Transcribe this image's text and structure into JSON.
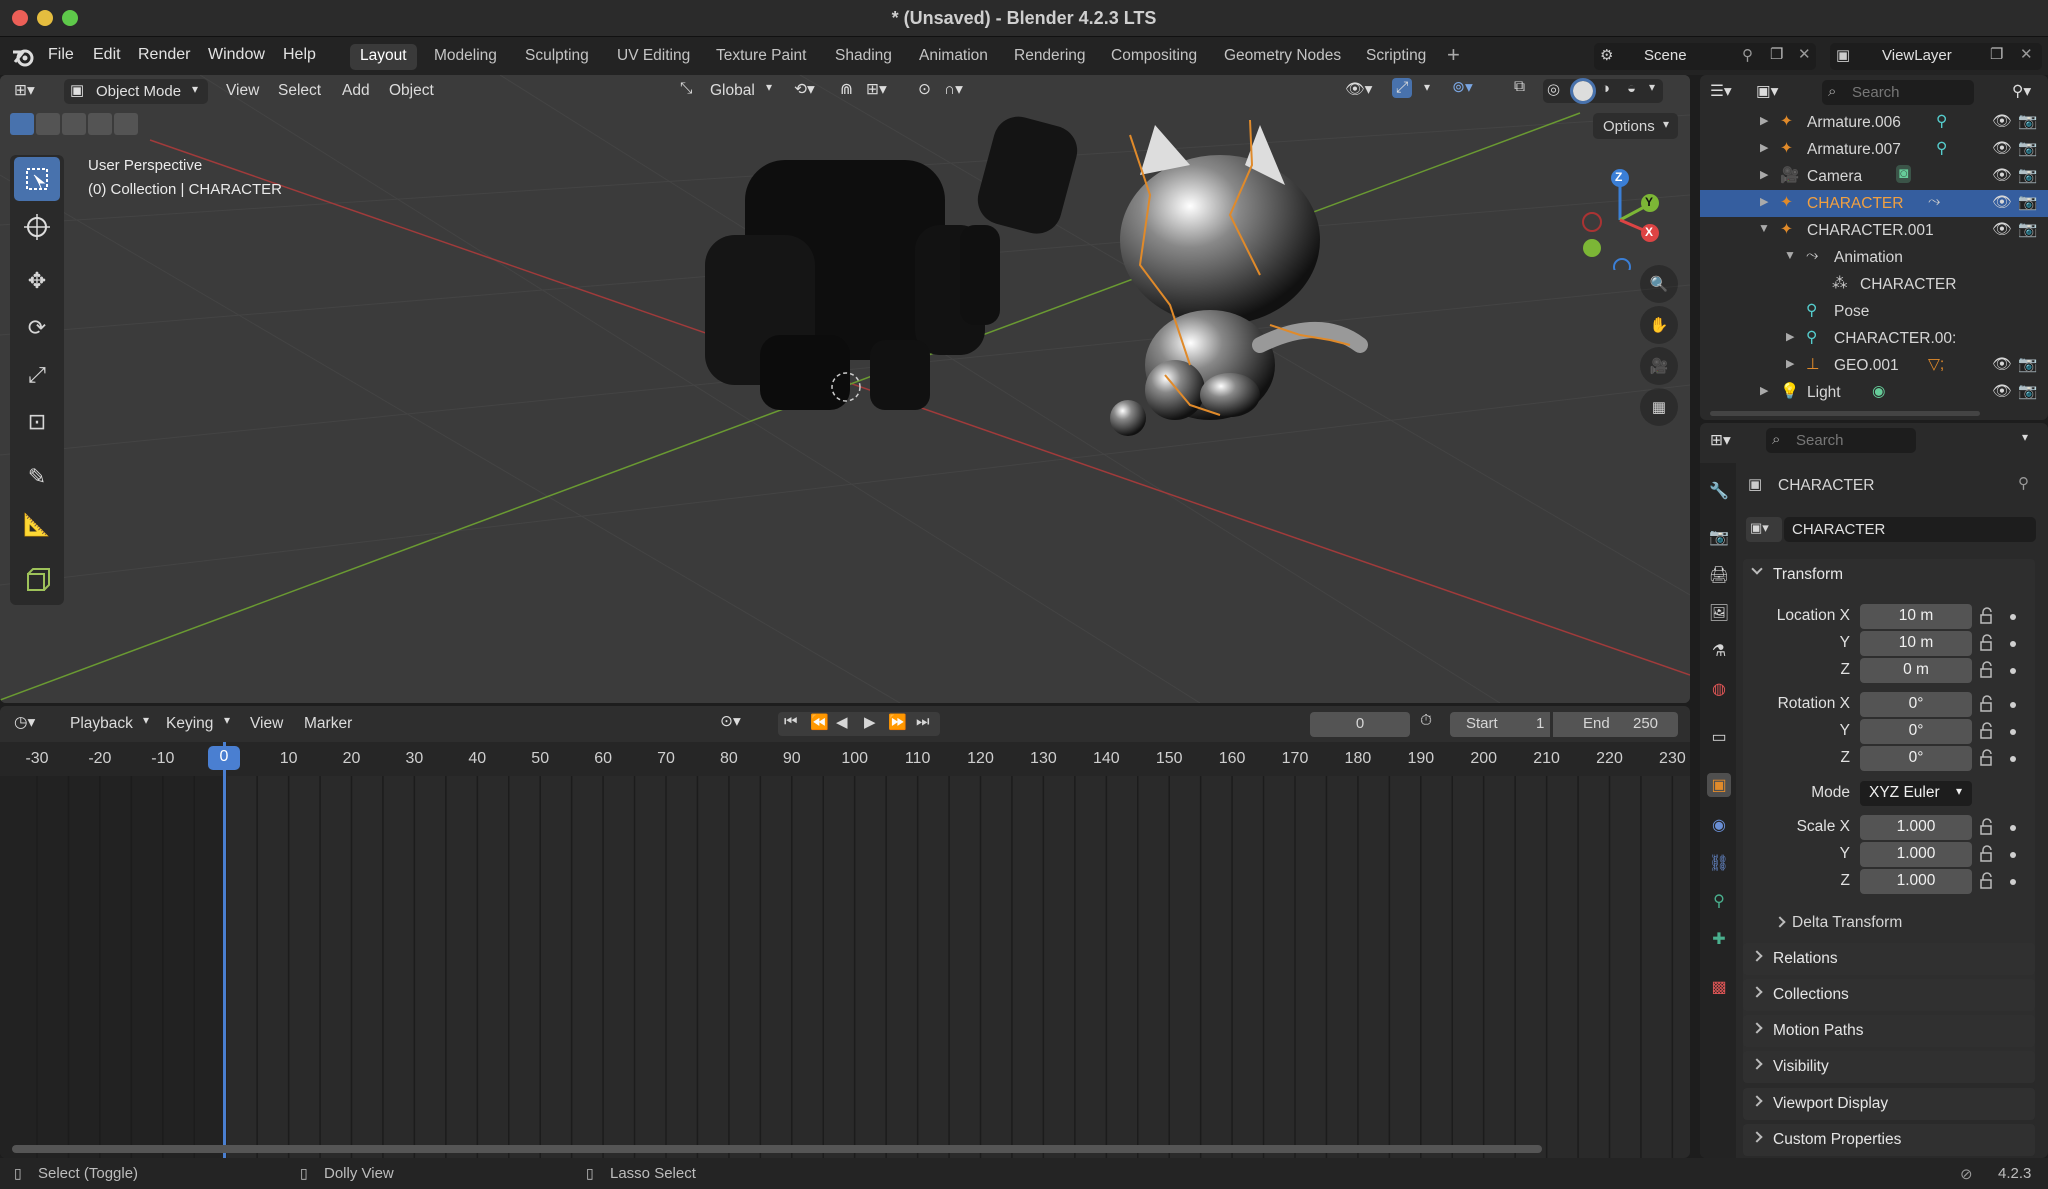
{
  "window": {
    "title": "* (Unsaved) - Blender 4.2.3 LTS"
  },
  "menu": [
    "File",
    "Edit",
    "Render",
    "Window",
    "Help"
  ],
  "workspaces": [
    "Layout",
    "Modeling",
    "Sculpting",
    "UV Editing",
    "Texture Paint",
    "Shading",
    "Animation",
    "Rendering",
    "Compositing",
    "Geometry Nodes",
    "Scripting"
  ],
  "active_workspace": "Layout",
  "scene": {
    "name": "Scene",
    "viewlayer": "ViewLayer"
  },
  "viewport": {
    "mode": "Object Mode",
    "menus": [
      "View",
      "Select",
      "Add",
      "Object"
    ],
    "orientation": "Global",
    "options_label": "Options",
    "info_line1": "User Perspective",
    "info_line2": "(0) Collection | CHARACTER",
    "gizmo_axes": {
      "z": "Z",
      "y": "Y",
      "x": "X"
    }
  },
  "timeline": {
    "menus": [
      "Playback",
      "Keying",
      "View",
      "Marker"
    ],
    "current_frame": "0",
    "start_label": "Start",
    "start": "1",
    "end_label": "End",
    "end": "250",
    "ticks": [
      "-30",
      "-20",
      "-10",
      "0",
      "10",
      "20",
      "30",
      "40",
      "50",
      "60",
      "70",
      "80",
      "90",
      "100",
      "110",
      "120",
      "130",
      "140",
      "150",
      "160",
      "170",
      "180",
      "190",
      "200",
      "210",
      "220",
      "230"
    ]
  },
  "outliner": {
    "search_placeholder": "Search",
    "rows": [
      {
        "label": "Armature.006"
      },
      {
        "label": "Armature.007"
      },
      {
        "label": "Camera"
      },
      {
        "label": "CHARACTER"
      },
      {
        "label": "CHARACTER.001"
      },
      {
        "label": "Animation"
      },
      {
        "label": "CHARACTER"
      },
      {
        "label": "Pose"
      },
      {
        "label": "CHARACTER.00:"
      },
      {
        "label": "GEO.001"
      },
      {
        "label": "Light"
      }
    ]
  },
  "properties": {
    "search_placeholder": "Search",
    "object_name": "CHARACTER",
    "object_field": "CHARACTER",
    "transform_label": "Transform",
    "location_labels": [
      "Location X",
      "Y",
      "Z"
    ],
    "location": [
      "10 m",
      "10 m",
      "0 m"
    ],
    "rotation_labels": [
      "Rotation X",
      "Y",
      "Z"
    ],
    "rotation": [
      "0°",
      "0°",
      "0°"
    ],
    "mode_label": "Mode",
    "mode": "XYZ Euler",
    "scale_labels": [
      "Scale X",
      "Y",
      "Z"
    ],
    "scale": [
      "1.000",
      "1.000",
      "1.000"
    ],
    "delta": "Delta Transform",
    "panels": [
      "Relations",
      "Collections",
      "Motion Paths",
      "Visibility",
      "Viewport Display",
      "Custom Properties"
    ]
  },
  "status": {
    "left": "Select (Toggle)",
    "middle": "Dolly View",
    "right": "Lasso Select",
    "version": "4.2.3"
  }
}
